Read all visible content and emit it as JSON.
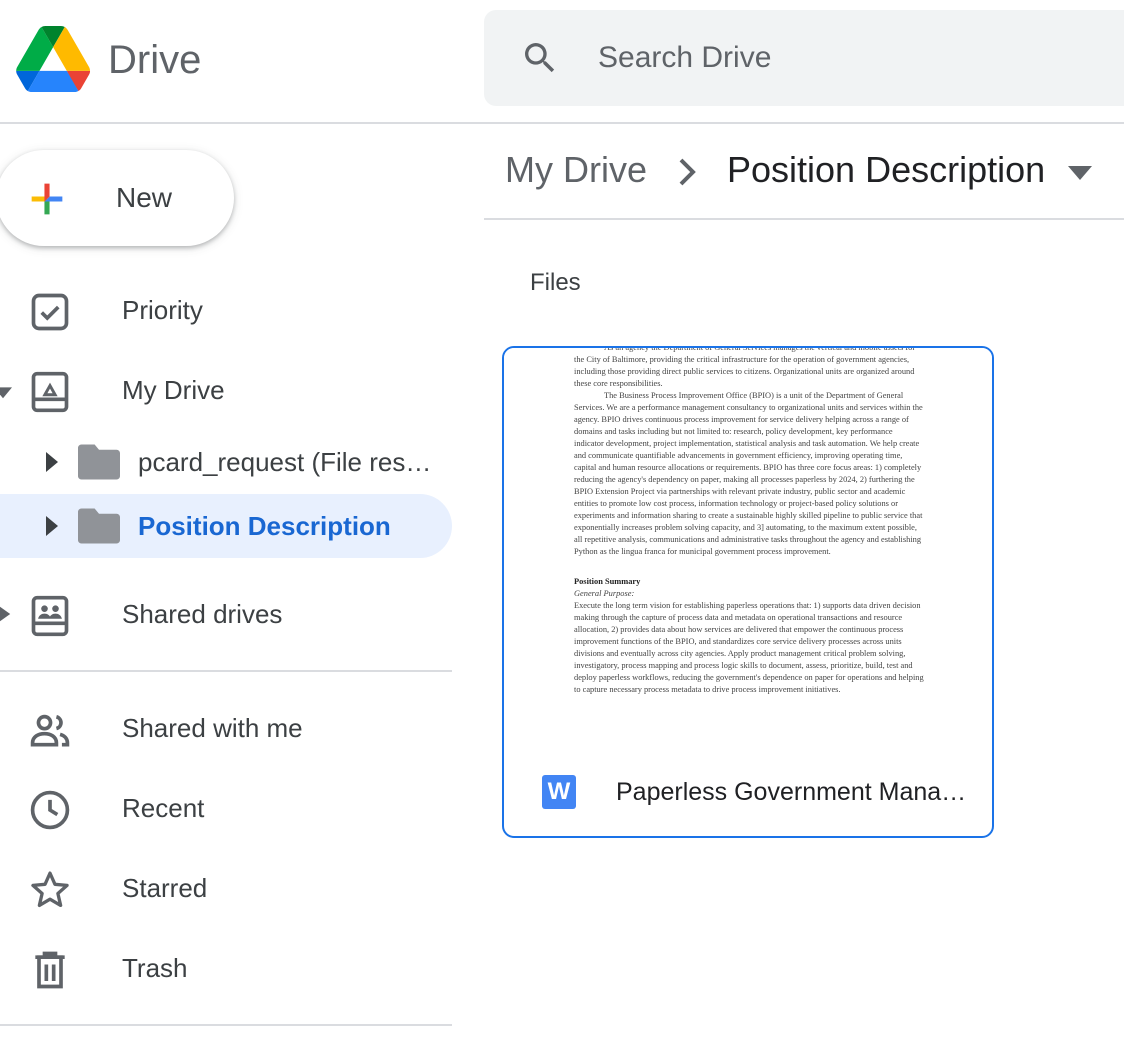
{
  "app": {
    "brand": "Drive"
  },
  "search": {
    "placeholder": "Search Drive"
  },
  "new_button": {
    "label": "New"
  },
  "sidebar": {
    "priority": "Priority",
    "my_drive": "My Drive",
    "tree": [
      {
        "label": "pcard_request (File responses)",
        "active": false
      },
      {
        "label": "Position Description",
        "active": true
      }
    ],
    "shared_drives": "Shared drives",
    "shared_with_me": "Shared with me",
    "recent": "Recent",
    "starred": "Starred",
    "trash": "Trash"
  },
  "breadcrumb": {
    "root": "My Drive",
    "current": "Position Description"
  },
  "main": {
    "section_title": "Files",
    "files": [
      {
        "name": "Paperless Government Management",
        "type_icon": "W",
        "preview": {
          "para1": "As an agency the Department of General Services manages the vertical and mobile assets for the City of Baltimore, providing the critical infrastructure for the operation of government agencies, including those providing direct public services to citizens. Organizational units are organized around these core responsibilities.",
          "para2": "The Business Process Improvement Office (BPIO) is a unit of the Department of General Services. We are a performance management consultancy to organizational units and services within the agency. BPIO drives continuous process improvement for service delivery helping across a range of domains and tasks including but not limited to: research, policy development, key performance indicator development, project implementation, statistical analysis and task automation. We help create and communicate quantifiable advancements in government efficiency, improving operating time, capital and human resource allocations or requirements. BPIO has three core focus areas: 1) completely reducing the agency's dependency on paper, making all processes paperless by 2024, 2) furthering the BPIO Extension Project via partnerships with relevant private industry, public sector and academic entities to promote low cost process, information technology or project-based policy solutions or experiments and information sharing to create a sustainable highly skilled pipeline to public service that exponentially increases problem solving capacity, and 3] automating, to the maximum extent possible, all repetitive analysis, communications and administrative tasks throughout the agency and establishing Python as the lingua franca for municipal government process improvement.",
          "heading": "Position Summary",
          "subheading": "General Purpose:",
          "para3": "Execute the long term vision for establishing paperless operations that: 1) supports data driven decision making through the capture of process data and metadata on operational transactions and resource allocation, 2) provides data about how services are delivered that empower the continuous process improvement functions of the BPIO, and standardizes core service delivery processes across units divisions and eventually across city agencies. Apply product management critical problem solving, investigatory, process mapping and process logic skills to document, assess, prioritize, build, test and deploy paperless workflows, reducing the government's dependence on paper for operations and helping to capture necessary process metadata to drive process improvement initiatives."
        }
      }
    ]
  },
  "colors": {
    "accent": "#1a73e8",
    "active_bg": "#e8f0fe",
    "active_text": "#1967d2",
    "folder": "#909398"
  }
}
